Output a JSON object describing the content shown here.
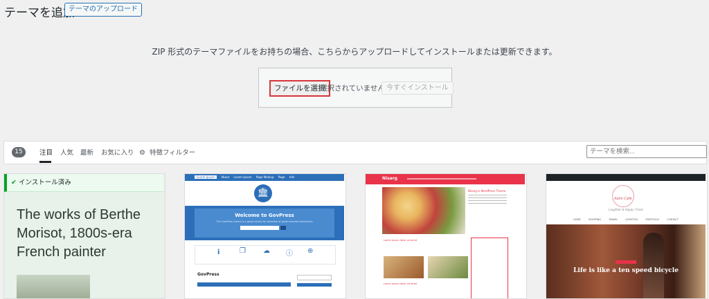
{
  "header": {
    "title": "テーマを追加",
    "upload_button": "テーマのアップロード"
  },
  "upload": {
    "description": "ZIP 形式のテーマファイルをお持ちの場合、こちらからアップロードしてインストールまたは更新できます。",
    "choose_file": "ファイルを選択",
    "no_file": "選択されていません",
    "install_now": "今すぐインストール"
  },
  "filter": {
    "count": "15",
    "tabs": [
      "注目",
      "人気",
      "最新",
      "お気に入り"
    ],
    "feature_filter": "特徴フィルター",
    "search_placeholder": "テーマを検索..."
  },
  "cards": {
    "installed_label": "インストール済み",
    "card1_text": "The works of Berthe Morisot, 1800s-era French painter",
    "govpress": {
      "nav": [
        "Lorem Ipsum",
        "About",
        "Lorem Ipsum",
        "Page Markup",
        "Page",
        "Info"
      ],
      "hero_title": "Welcome to GovPress",
      "hero_sub": "The GovPress theme is a great choice for websites of governmental institutions",
      "name": "GovPress"
    },
    "nisarg": {
      "logo": "Nisarg",
      "post_title": "Nisarg is WordPress Theme",
      "section": "Lorem ipsum dolor sit amet",
      "post2": "Lorem ipsum dolor sit amet"
    },
    "kalm": {
      "tagline": "Kalm Cafe",
      "subtitle": "Laughter & Happy Times",
      "nav": [
        "HOME",
        "SHOPPING",
        "TRAVEL",
        "LIFESTYLE",
        "PORTFOLIO",
        "CONTACT"
      ],
      "hero": "Life is like a ten speed bicycle"
    }
  },
  "colors": {
    "accent": "#2271b1",
    "installed": "#00a32a",
    "highlight": "#d63638",
    "govpress_blue": "#2c6fb8",
    "nisarg_red": "#e8334a"
  }
}
